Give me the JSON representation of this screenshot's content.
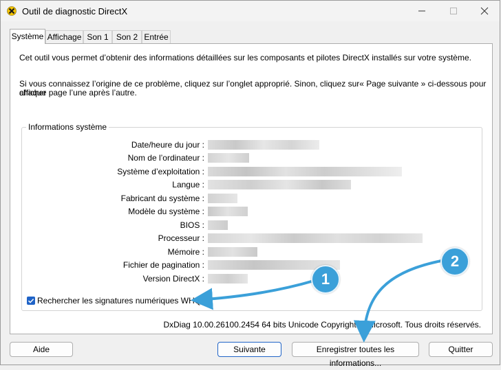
{
  "window": {
    "title": "Outil de diagnostic DirectX"
  },
  "tabs": [
    "Système",
    "Affichage",
    "Son 1",
    "Son 2",
    "Entrée"
  ],
  "active_tab": "Système",
  "intro": {
    "line1": "Cet outil vous permet d’obtenir des informations détaillées sur les composants et pilotes DirectX installés sur votre système.",
    "line2a": "Si vous connaissez l’origine de ce problème, cliquez sur l’onglet approprié. Sinon, cliquez sur« Page suivante » ci-dessous pour afficher",
    "line2b": "chaque page l’une après l’autre."
  },
  "system_info": {
    "group_title": "Informations système",
    "rows": [
      {
        "label": "Date/heure du jour :"
      },
      {
        "label": "Nom de l’ordinateur :"
      },
      {
        "label": "Système d’exploitation :"
      },
      {
        "label": "Langue :"
      },
      {
        "label": "Fabricant du système :"
      },
      {
        "label": "Modèle du système :"
      },
      {
        "label": "BIOS :"
      },
      {
        "label": "Processeur :"
      },
      {
        "label": "Mémoire :"
      },
      {
        "label": "Fichier de pagination :"
      },
      {
        "label": "Version DirectX :"
      }
    ]
  },
  "whql_checkbox": {
    "label": "Rechercher les signatures numériques WHQL",
    "checked": true
  },
  "footer_info": "DxDiag 10.00.26100.2454 64 bits Unicode Copyright © Microsoft. Tous droits réservés.",
  "buttons": {
    "help": "Aide",
    "next": "Suivante",
    "save_all": "Enregistrer toutes les informations...",
    "quit": "Quitter"
  },
  "callouts": [
    "1",
    "2"
  ],
  "colors": {
    "accent": "#1f63c7",
    "callout": "#3ba0d9"
  }
}
